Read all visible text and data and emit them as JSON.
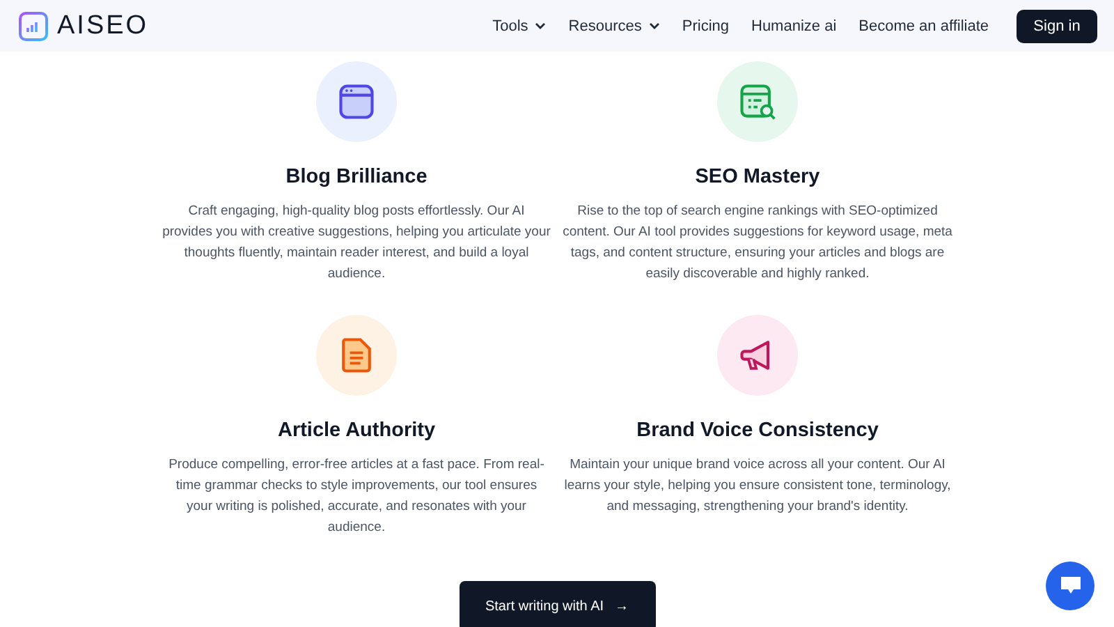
{
  "header": {
    "logo": "AISEO",
    "nav": [
      {
        "label": "Tools",
        "kind": "dropdown"
      },
      {
        "label": "Resources",
        "kind": "dropdown"
      },
      {
        "label": "Pricing",
        "kind": "link"
      },
      {
        "label": "Humanize ai",
        "kind": "link"
      },
      {
        "label": "Become an affiliate",
        "kind": "link"
      }
    ],
    "sign_in": "Sign in"
  },
  "features": [
    {
      "title": "Blog Brilliance",
      "text": "Craft engaging, high-quality blog posts effortlessly. Our AI provides you with creative suggestions, helping you articulate your thoughts fluently, maintain reader interest, and build a loyal audience."
    },
    {
      "title": "SEO Mastery",
      "text": "Rise to the top of search engine rankings with SEO-optimized content. Our AI tool provides suggestions for keyword usage, meta tags, and content structure, ensuring your articles and blogs are easily discoverable and highly ranked."
    },
    {
      "title": "Article Authority",
      "text": "Produce compelling, error-free articles at a fast pace. From real-time grammar checks to style improvements, our tool ensures your writing is polished, accurate, and resonates with your audience."
    },
    {
      "title": "Brand Voice Consistency",
      "text": "Maintain your unique brand voice across all your content. Our AI learns your style, helping you ensure consistent tone, terminology, and messaging, strengthening your brand's identity."
    }
  ],
  "cta": {
    "label": "Start writing with AI",
    "arrow": "→"
  }
}
